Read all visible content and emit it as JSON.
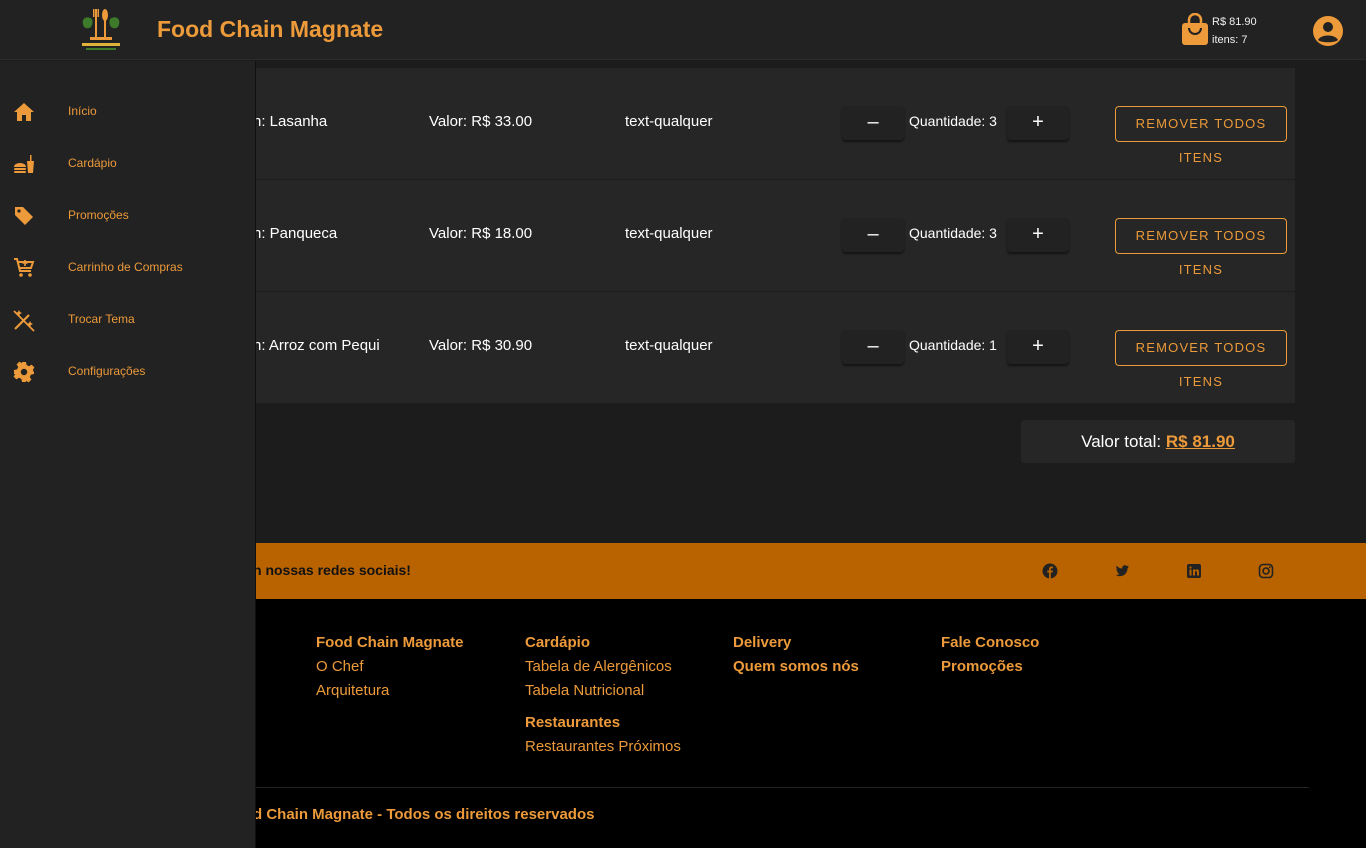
{
  "header": {
    "title": "Food Chain Magnate",
    "cart_total": "R$ 81.90",
    "cart_items": "itens: 7",
    "logo_icon": "restaurant-logo-icon",
    "bag_icon": "shopping-bag-icon",
    "account_icon": "account-circle-icon"
  },
  "sidebar": {
    "items": [
      {
        "label": "Início",
        "icon": "home-icon"
      },
      {
        "label": "Cardápio",
        "icon": "fastfood-icon"
      },
      {
        "label": "Promoções",
        "icon": "tag-icon"
      },
      {
        "label": "Carrinho de Compras",
        "icon": "cart-icon"
      },
      {
        "label": "Trocar Tema",
        "icon": "theme-wand-icon"
      },
      {
        "label": "Configurações",
        "icon": "gear-icon"
      }
    ]
  },
  "cart": {
    "items": [
      {
        "name": "n: Lasanha",
        "price": "Valor: R$ 33.00",
        "desc": "text-qualquer",
        "quantity": "Quantidade: 3",
        "minus": "–",
        "plus": "+",
        "remove": "REMOVER TODOS ITENS"
      },
      {
        "name": "n: Panqueca",
        "price": "Valor: R$ 18.00",
        "desc": "text-qualquer",
        "quantity": "Quantidade: 3",
        "minus": "–",
        "plus": "+",
        "remove": "REMOVER TODOS ITENS"
      },
      {
        "name": "n: Arroz com Pequi",
        "price": "Valor: R$ 30.90",
        "desc": "text-qualquer",
        "quantity": "Quantidade: 1",
        "minus": "–",
        "plus": "+",
        "remove": "REMOVER TODOS ITENS"
      }
    ],
    "total_label": "Valor total:",
    "total_value": "R$ 81.90"
  },
  "social": {
    "text": "n nossas redes sociais!",
    "icons": [
      "facebook-icon",
      "twitter-icon",
      "linkedin-icon",
      "instagram-icon"
    ]
  },
  "footer": {
    "col1": {
      "heading": "Food Chain Magnate",
      "links": [
        "O Chef",
        "Arquitetura"
      ]
    },
    "col2": {
      "heading": "Cardápio",
      "links": [
        "Tabela de Alergênicos",
        "Tabela Nutricional"
      ],
      "heading2": "Restaurantes",
      "links2": [
        "Restaurantes Próximos"
      ]
    },
    "col3": {
      "heading": "Delivery",
      "heading2": "Quem somos nós"
    },
    "col4": {
      "heading": "Fale Conosco",
      "heading2": "Promoções"
    },
    "copyright": "d Chain Magnate - Todos os direitos reservados"
  },
  "colors": {
    "accent": "#ec9a3a",
    "band": "#b86300",
    "background": "#1c1c1c",
    "surface": "#262626"
  }
}
